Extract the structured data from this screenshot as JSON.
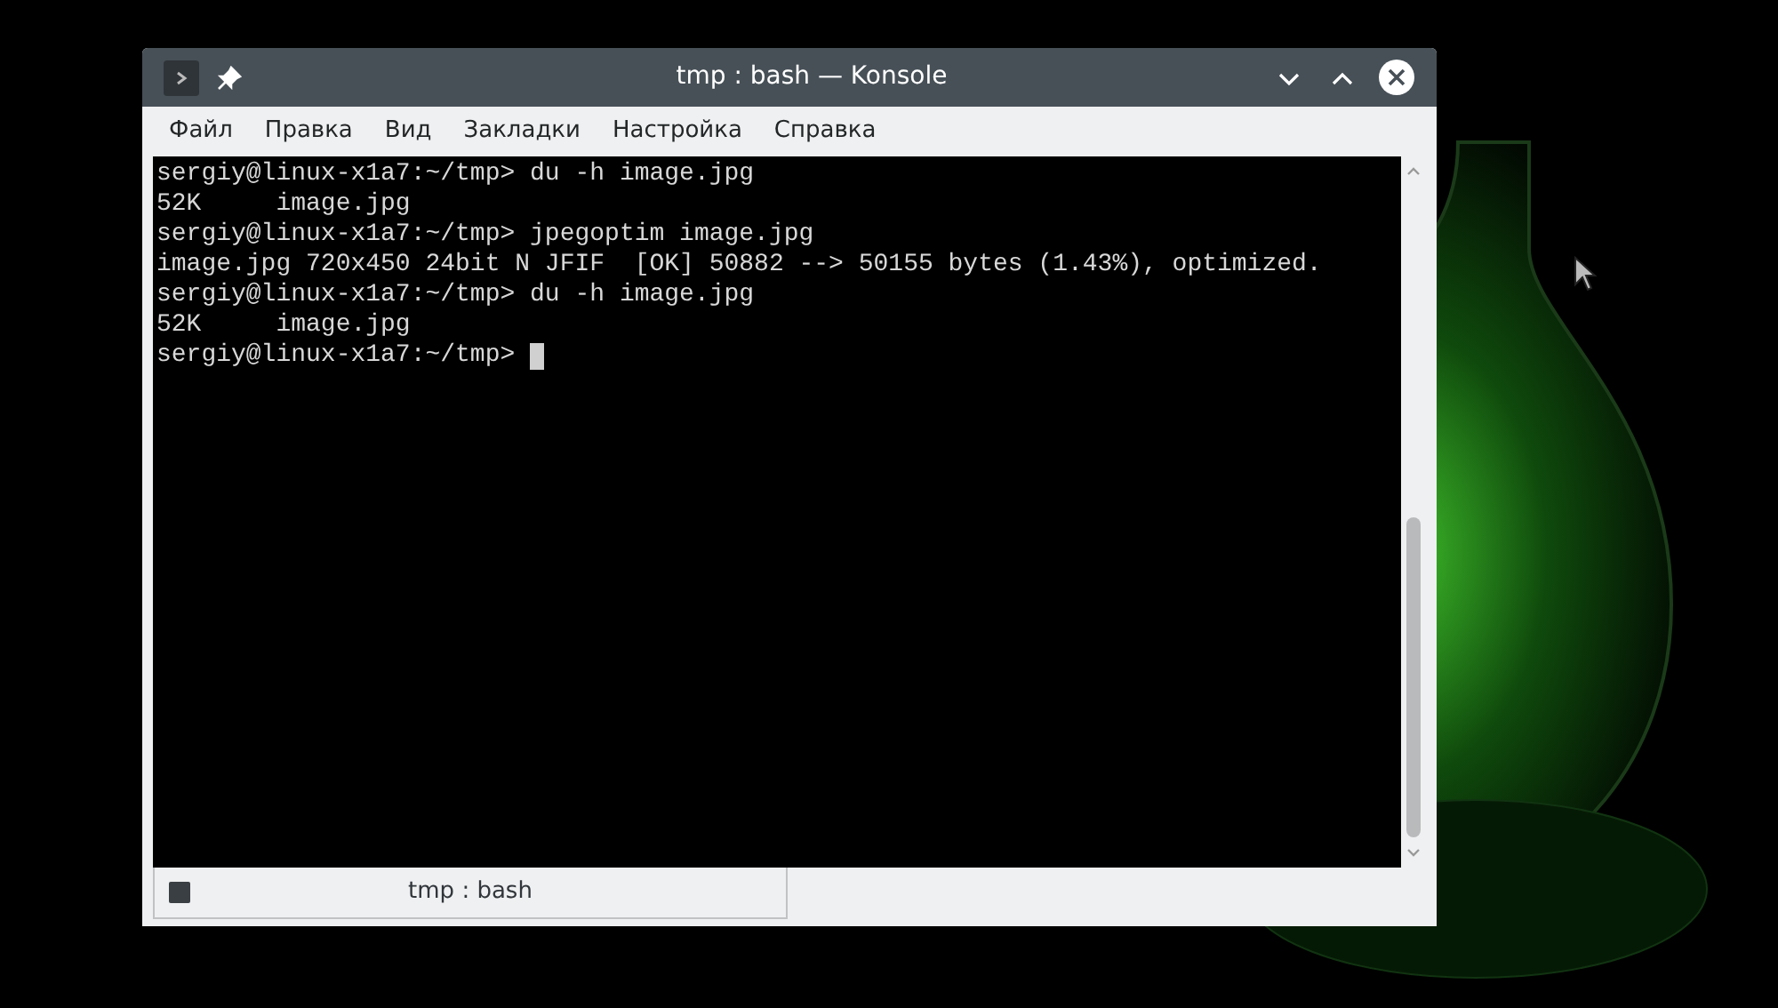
{
  "window": {
    "title": "tmp : bash — Konsole"
  },
  "menu": [
    "Файл",
    "Правка",
    "Вид",
    "Закладки",
    "Настройка",
    "Справка"
  ],
  "terminal": {
    "lines": [
      "sergiy@linux-x1a7:~/tmp> du -h image.jpg",
      "52K     image.jpg",
      "sergiy@linux-x1a7:~/tmp> jpegoptim image.jpg",
      "image.jpg 720x450 24bit N JFIF  [OK] 50882 --> 50155 bytes (1.43%), optimized.",
      "sergiy@linux-x1a7:~/tmp> du -h image.jpg",
      "52K     image.jpg",
      "sergiy@linux-x1a7:~/tmp> "
    ]
  },
  "tabs": [
    {
      "label": "tmp : bash",
      "selected": true
    }
  ]
}
